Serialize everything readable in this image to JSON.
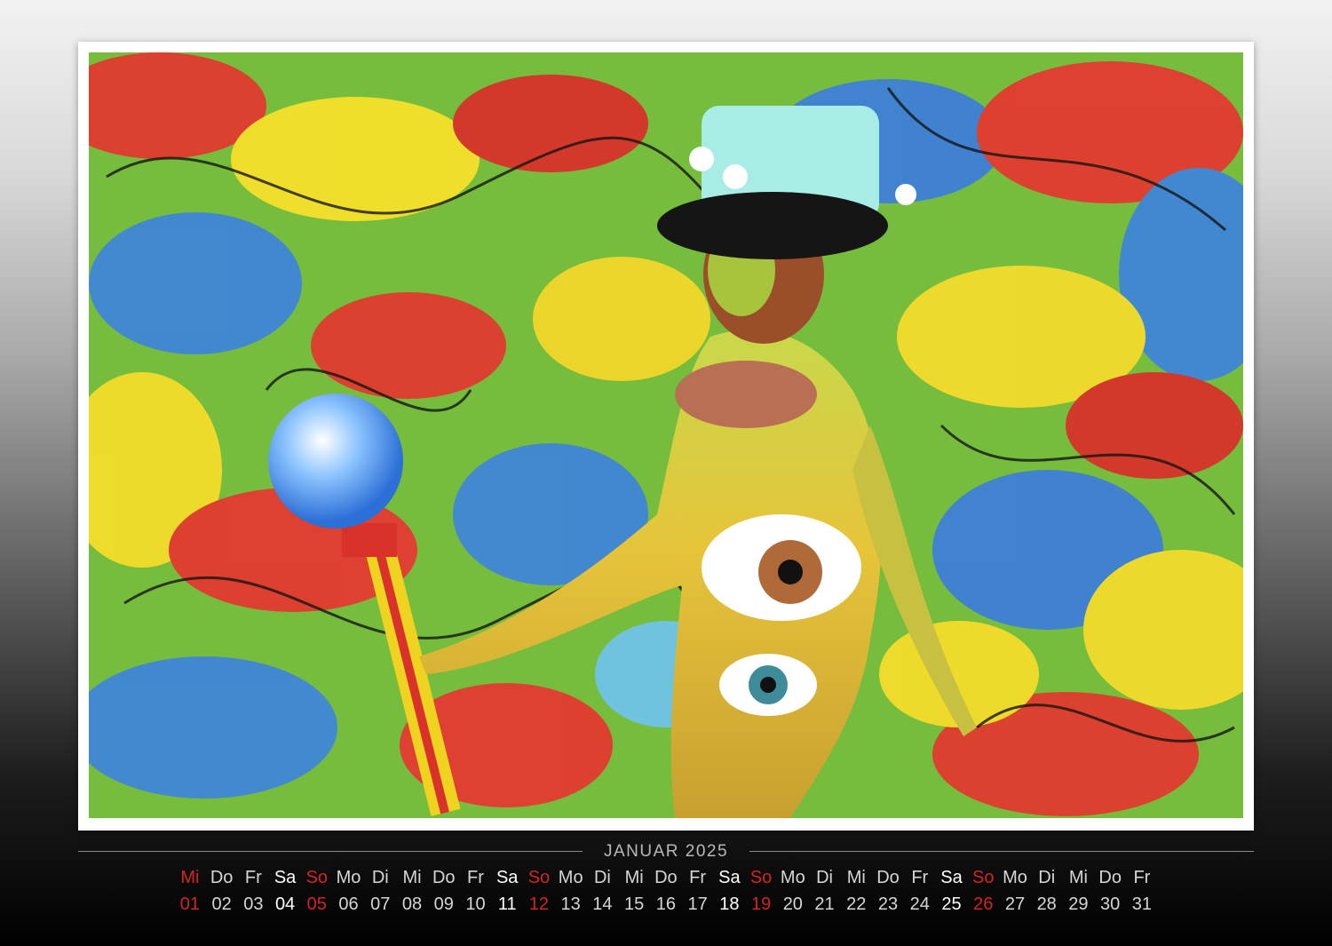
{
  "calendar": {
    "month_title": "JANUAR 2025",
    "weekdays": [
      "Mi",
      "Do",
      "Fr",
      "Sa",
      "So",
      "Mo",
      "Di",
      "Mi",
      "Do",
      "Fr",
      "Sa",
      "So",
      "Mo",
      "Di",
      "Mi",
      "Do",
      "Fr",
      "Sa",
      "So",
      "Mo",
      "Di",
      "Mi",
      "Do",
      "Fr",
      "Sa",
      "So",
      "Mo",
      "Di",
      "Mi",
      "Do",
      "Fr"
    ],
    "dates": [
      "01",
      "02",
      "03",
      "04",
      "05",
      "06",
      "07",
      "08",
      "09",
      "10",
      "11",
      "12",
      "13",
      "14",
      "15",
      "16",
      "17",
      "18",
      "19",
      "20",
      "21",
      "22",
      "23",
      "24",
      "25",
      "26",
      "27",
      "28",
      "29",
      "30",
      "31"
    ],
    "holiday_indices": [
      0
    ],
    "colors": {
      "weekday": "#d6d6d6",
      "saturday": "#ffffff",
      "sunday_holiday": "#d42424"
    }
  }
}
